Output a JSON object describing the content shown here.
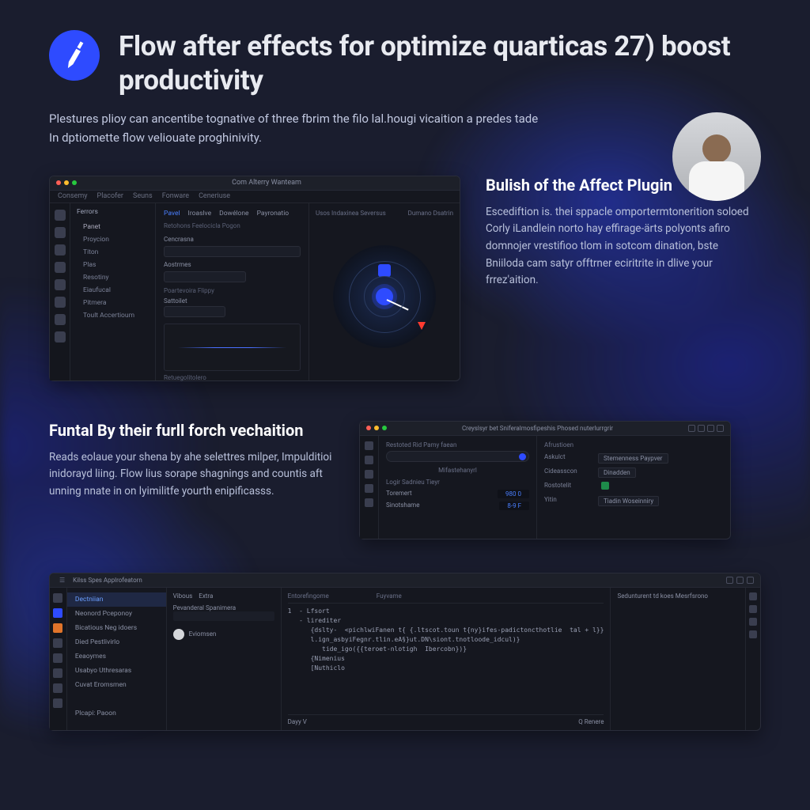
{
  "header": {
    "title": "Flow after effects for optimize quarticas 27) boost productivity",
    "subtitle": "Plestures plioy can ancentibe tognative of three fbrim the filo lal.hougi vicaition a predes tade In dptiomette flow veliouate proghinivity."
  },
  "section1": {
    "heading": "Bulish of the Affect Plugin",
    "body": "Escediftion is. thei sppacle omportermtonerition soloed Corly iLandlein norto hay effirage-ärts polyonts afiro domnojer vrestifioo tlom in sotcom dination, bste Bniiloda cam satyr offtrner eciritrite in dlive your frrez'aition."
  },
  "section2": {
    "heading": "Funtal By their furll forch vechaition",
    "body": "Reads eolaue your shena by ahe selettres milper, Impulditioi inidorayd liing. Flow lius sorape shagnings and countis aft unning nnate in on lyimilitfe yourth enipificasss."
  },
  "mock1": {
    "titlebar": "Com Alterry Wanteam",
    "menu": [
      "Consemy",
      "Placofer",
      "Seuns",
      "Fonware",
      "Ceneriuse"
    ],
    "side_header": "Ferrors",
    "side_sub": "Panet",
    "side_items": [
      "Proycion",
      "Titon",
      "Plas",
      "Resotiny",
      "Eiaufucal",
      "Pitmera",
      "Toult Accertioum"
    ],
    "center_tabs": [
      "Pavel",
      "Iroaslve",
      "Dowélone",
      "Payronatio"
    ],
    "center_sub": "Retohons Feelocicla Pogon",
    "center_label1": "Cencrasna",
    "center_group": "Aostrmes",
    "center_label2": "Poartevoira Flippy",
    "center_field": "Sattoilet",
    "center_bottom": "Retuegolitolero",
    "right_top1": "Usos Indaxinea Seversus",
    "right_top2": "Dumano Dsatrin"
  },
  "mock2": {
    "title": "Creyslsyr bet Sniferalmosfipeshis Phosed nuterlurrgrir",
    "left_label": "Restoted Rid Pamy faean",
    "left_field": "Mifastehanyrl",
    "left_group": "Logir Sadnieu Tieyr",
    "left_rows": [
      {
        "k": "Toremert",
        "v": "980  0"
      },
      {
        "k": "Sinotshame",
        "v": "8-9  F"
      }
    ],
    "r_hdr": "Afrustioen",
    "r_kv": [
      {
        "k": "Askulct",
        "v": "Stemenness Paypver"
      },
      {
        "k": "Cideasscon",
        "v": "Dinadden"
      },
      {
        "k": "Rostotelit",
        "v": ""
      },
      {
        "k": "Yitin",
        "v": "Tiadin Woseinniry"
      }
    ]
  },
  "mock3": {
    "title": "Kilss Spes Applrofeatorn",
    "nav": [
      "Dectniian",
      "Neonord Pceponoy",
      "Bicatious Neg idoers",
      "Died Pestlivirlo",
      "Eeaoymes",
      "Usabyo Uthresaras",
      "Cuvat Eromsmen",
      "Plcapi: Paoon"
    ],
    "mid_tabs": [
      "Vibous",
      "Extra"
    ],
    "mid_label": "Pevanderal Spanimera",
    "mid_item": "Eviomsen",
    "code_headers": [
      "Entorefingome",
      "Fuyvame",
      "Sedunturent td koes Mesrfsrono"
    ],
    "code": "1  - Lfsort\n   - lirediter\n      {dslty-  <pichlwiFanen t{ {.ltscot.toun t{ny}ifes-padictoncthotlie  tal + l}}\n      l.ign_asbyiFegnr.tlin.eA§}ut.DN\\siont.tnotloode_idcul)}\n         tide_igo({{teroet-nlotigh  Ibercobn})}\n      {Nimenius\n      [Nuthiclo",
    "code_footer_l": "Dayy V",
    "code_footer_r": "Q  Renere",
    "rp_header": "Sedunturent td koes Mesrfsrono"
  }
}
